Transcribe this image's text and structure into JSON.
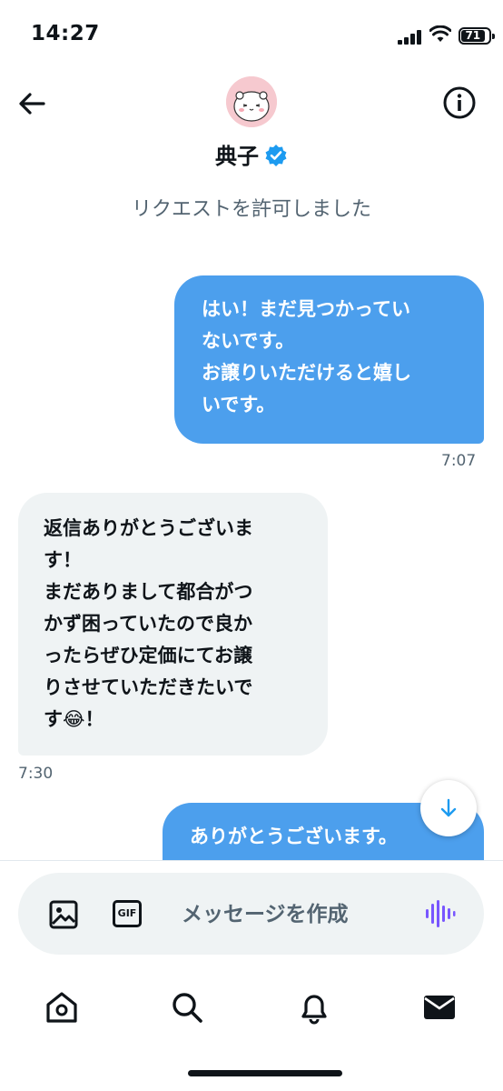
{
  "status_bar": {
    "time": "14:27",
    "battery": "71",
    "icons": [
      "signal-icon",
      "wifi-icon",
      "battery-icon"
    ]
  },
  "header": {
    "name": "典子",
    "verified_icon": "verified-badge-icon",
    "back_icon": "back-arrow-icon",
    "info_icon": "info-icon",
    "request_notice": "リクエストを許可しました"
  },
  "messages": [
    {
      "direction": "outgoing",
      "text": "はい！まだ見つかってい\nないです。\nお譲りいただけると嬉し\nいです。",
      "time": "7:07"
    },
    {
      "direction": "incoming",
      "text": "返信ありがとうございま\nす！\nまだありまして都合がつ\nかず困っていたので良か\nったらぜひ定価にてお譲\nりさせていただきたいで\nす😂！",
      "time": "7:30"
    },
    {
      "direction": "outgoing",
      "text": "ありがとうございます。",
      "time": ""
    }
  ],
  "composer": {
    "placeholder": "メッセージを作成",
    "gif_label": "GIF",
    "image_icon": "image-icon",
    "voice_icon": "voice-wave-icon",
    "accent_color": "#7856ff"
  },
  "tabbar": {
    "items": [
      "home-icon",
      "search-icon",
      "notifications-icon",
      "messages-icon"
    ]
  },
  "colors": {
    "outgoing_bubble": "#4c9fed",
    "incoming_bubble": "#eff3f4",
    "secondary_text": "#536471"
  }
}
